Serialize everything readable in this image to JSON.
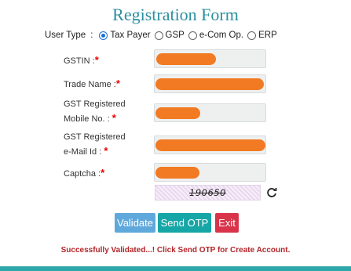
{
  "form": {
    "title": "Registration Form",
    "user_type_label": "User Type",
    "user_type_colon": ":",
    "user_type_options": [
      {
        "label": "Tax Payer",
        "selected": true
      },
      {
        "label": "GSP",
        "selected": false
      },
      {
        "label": "e-Com Op.",
        "selected": false
      },
      {
        "label": "ERP",
        "selected": false
      }
    ],
    "fields": {
      "gstin": {
        "label": ":",
        "label_text": "GSTIN",
        "required": "*"
      },
      "trade_name": {
        "label_text": "Trade Name :",
        "required": "*"
      },
      "mobile": {
        "label_line1": "GST Registered",
        "label_line2": "Mobile No. :",
        "required": "*"
      },
      "email": {
        "label_line1": "GST Registered",
        "label_line2": "e-Mail Id :",
        "required": "*"
      },
      "captcha": {
        "label_text": "Captcha :",
        "required": "*"
      }
    },
    "captcha_text": "190650",
    "buttons": {
      "validate": "Validate",
      "send_otp": "Send OTP",
      "exit": "Exit"
    },
    "status_message": "Successfully Validated...! Click Send OTP for Create Account."
  },
  "colors": {
    "title": "#2a8f9e",
    "redaction": "#f27a22",
    "validate": "#5fa8db",
    "send_otp": "#16a6a6",
    "exit": "#d9334a",
    "status": "#b3262a"
  },
  "icons": {
    "refresh": "refresh-icon"
  }
}
